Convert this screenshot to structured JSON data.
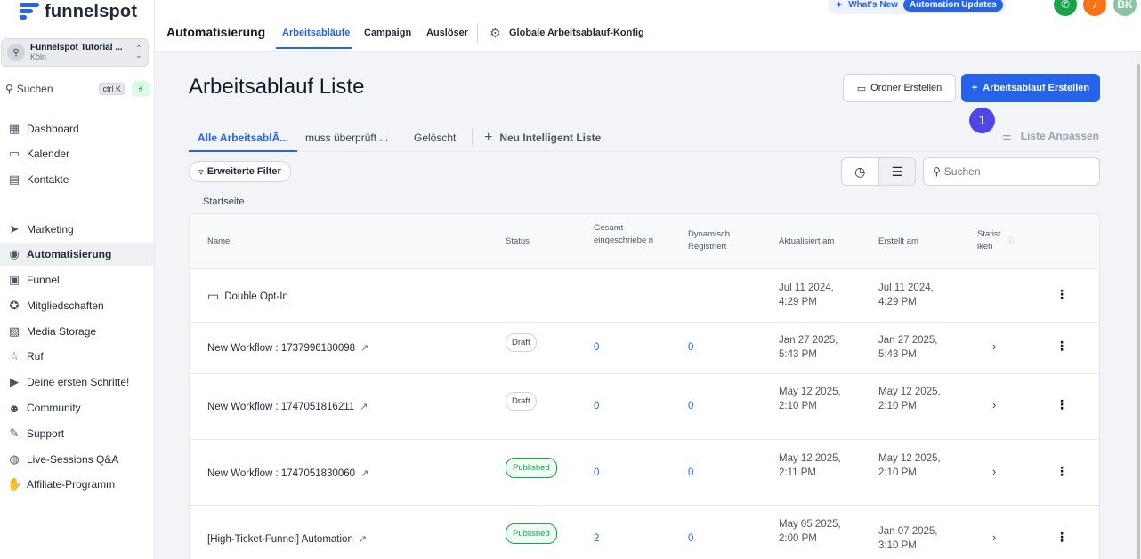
{
  "brand": {
    "name": "funnelspot"
  },
  "account": {
    "name": "Funnelspot Tutorial ...",
    "location": "Köln"
  },
  "sidebar": {
    "search_label": "Suchen",
    "search_shortcut": "ctrl K",
    "items": [
      {
        "label": "Dashboard",
        "icon": "dashboard-icon"
      },
      {
        "label": "Kalender",
        "icon": "calendar-icon"
      },
      {
        "label": "Kontakte",
        "icon": "contacts-icon"
      },
      {
        "label": "Marketing",
        "icon": "send-icon"
      },
      {
        "label": "Automatisierung",
        "icon": "automation-icon"
      },
      {
        "label": "Funnel",
        "icon": "funnel-icon"
      },
      {
        "label": "Mitgliedschaften",
        "icon": "award-icon"
      },
      {
        "label": "Media Storage",
        "icon": "image-icon"
      },
      {
        "label": "Ruf",
        "icon": "star-icon"
      },
      {
        "label": "Deine ersten Schritte!",
        "icon": "play-icon"
      },
      {
        "label": "Community",
        "icon": "users-icon"
      },
      {
        "label": "Support",
        "icon": "wrench-icon"
      },
      {
        "label": "Live-Sessions Q&A",
        "icon": "chat-icon"
      },
      {
        "label": "Affiliate-Programm",
        "icon": "hand-coin-icon"
      }
    ]
  },
  "topbar": {
    "title": "Automatisierung",
    "tabs": [
      "Arbeitsabläufe",
      "Campaign",
      "Auslöser"
    ],
    "config_label": "Globale Arbeitsablauf-Konfig",
    "whats_new": "What's New",
    "updates_badge": "Automation Updates",
    "avatar_initials": "BK",
    "colors": {
      "phone": "#16a34a",
      "notify": "#f97316",
      "avatar": "#86c5a0"
    }
  },
  "main": {
    "title": "Arbeitsablauf Liste",
    "folder_button": "Ordner Erstellen",
    "create_button": "Arbeitsablauf Erstellen",
    "step_number": "1",
    "subtabs": [
      "Alle ArbeitsablÃ...",
      "muss überprüft ...",
      "Gelöscht"
    ],
    "new_list": "Neu Intelligent Liste",
    "customize": "Liste Anpassen",
    "filter_label": "Erweiterte Filter",
    "search_placeholder": "Suchen",
    "breadcrumb": "Startseite"
  },
  "table": {
    "headers": {
      "name": "Name",
      "status": "Status",
      "total": "Gesamt eingeschriebe n",
      "dynamic": "Dynamisch Registriert",
      "updated": "Aktualisiert am",
      "created": "Erstellt am",
      "stats": "Statist iken"
    },
    "rows": [
      {
        "name": "Double Opt-In",
        "type": "folder",
        "status": "",
        "total": "",
        "dynamic": "",
        "updated": "Jul 11 2024, 4:29 PM",
        "created": "Jul 11 2024, 4:29 PM"
      },
      {
        "name": "New Workflow : 1737996180098",
        "type": "workflow",
        "status": "Draft",
        "total": "0",
        "dynamic": "0",
        "updated": "Jan 27 2025, 5:43 PM",
        "created": "Jan 27 2025, 5:43 PM"
      },
      {
        "name": "New Workflow : 1747051816211",
        "type": "workflow",
        "status": "Draft",
        "total": "0",
        "dynamic": "0",
        "updated": "May 12 2025, 2:10 PM",
        "created": "May 12 2025, 2:10 PM"
      },
      {
        "name": "New Workflow : 1747051830060",
        "type": "workflow",
        "status": "Published",
        "total": "0",
        "dynamic": "0",
        "updated": "May 12 2025, 2:11 PM",
        "created": "May 12 2025, 2:10 PM"
      },
      {
        "name": "[High-Ticket-Funnel] Automation",
        "type": "workflow",
        "status": "Published",
        "total": "2",
        "dynamic": "0",
        "updated": "May 05 2025, 2:00 PM",
        "created": "Jan 07 2025, 3:10 PM"
      }
    ]
  },
  "colors": {
    "accent": "#2563eb",
    "published": "#16a34a",
    "step_badge": "#4f46e5"
  }
}
